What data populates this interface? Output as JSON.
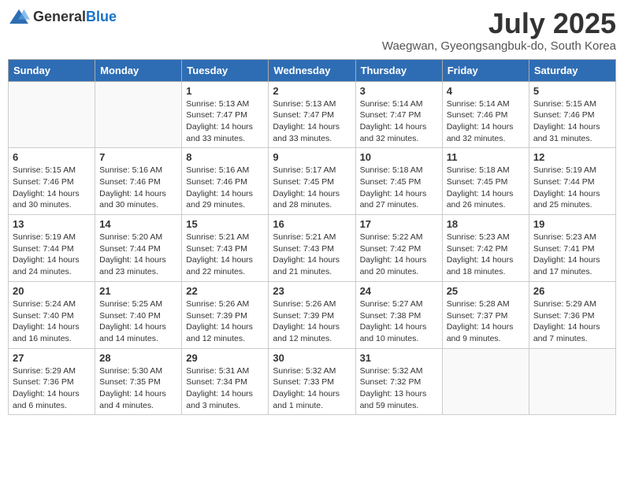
{
  "logo": {
    "general": "General",
    "blue": "Blue"
  },
  "title": "July 2025",
  "subtitle": "Waegwan, Gyeongsangbuk-do, South Korea",
  "headers": [
    "Sunday",
    "Monday",
    "Tuesday",
    "Wednesday",
    "Thursday",
    "Friday",
    "Saturday"
  ],
  "weeks": [
    [
      {
        "day": "",
        "text": ""
      },
      {
        "day": "",
        "text": ""
      },
      {
        "day": "1",
        "text": "Sunrise: 5:13 AM\nSunset: 7:47 PM\nDaylight: 14 hours and 33 minutes."
      },
      {
        "day": "2",
        "text": "Sunrise: 5:13 AM\nSunset: 7:47 PM\nDaylight: 14 hours and 33 minutes."
      },
      {
        "day": "3",
        "text": "Sunrise: 5:14 AM\nSunset: 7:47 PM\nDaylight: 14 hours and 32 minutes."
      },
      {
        "day": "4",
        "text": "Sunrise: 5:14 AM\nSunset: 7:46 PM\nDaylight: 14 hours and 32 minutes."
      },
      {
        "day": "5",
        "text": "Sunrise: 5:15 AM\nSunset: 7:46 PM\nDaylight: 14 hours and 31 minutes."
      }
    ],
    [
      {
        "day": "6",
        "text": "Sunrise: 5:15 AM\nSunset: 7:46 PM\nDaylight: 14 hours and 30 minutes."
      },
      {
        "day": "7",
        "text": "Sunrise: 5:16 AM\nSunset: 7:46 PM\nDaylight: 14 hours and 30 minutes."
      },
      {
        "day": "8",
        "text": "Sunrise: 5:16 AM\nSunset: 7:46 PM\nDaylight: 14 hours and 29 minutes."
      },
      {
        "day": "9",
        "text": "Sunrise: 5:17 AM\nSunset: 7:45 PM\nDaylight: 14 hours and 28 minutes."
      },
      {
        "day": "10",
        "text": "Sunrise: 5:18 AM\nSunset: 7:45 PM\nDaylight: 14 hours and 27 minutes."
      },
      {
        "day": "11",
        "text": "Sunrise: 5:18 AM\nSunset: 7:45 PM\nDaylight: 14 hours and 26 minutes."
      },
      {
        "day": "12",
        "text": "Sunrise: 5:19 AM\nSunset: 7:44 PM\nDaylight: 14 hours and 25 minutes."
      }
    ],
    [
      {
        "day": "13",
        "text": "Sunrise: 5:19 AM\nSunset: 7:44 PM\nDaylight: 14 hours and 24 minutes."
      },
      {
        "day": "14",
        "text": "Sunrise: 5:20 AM\nSunset: 7:44 PM\nDaylight: 14 hours and 23 minutes."
      },
      {
        "day": "15",
        "text": "Sunrise: 5:21 AM\nSunset: 7:43 PM\nDaylight: 14 hours and 22 minutes."
      },
      {
        "day": "16",
        "text": "Sunrise: 5:21 AM\nSunset: 7:43 PM\nDaylight: 14 hours and 21 minutes."
      },
      {
        "day": "17",
        "text": "Sunrise: 5:22 AM\nSunset: 7:42 PM\nDaylight: 14 hours and 20 minutes."
      },
      {
        "day": "18",
        "text": "Sunrise: 5:23 AM\nSunset: 7:42 PM\nDaylight: 14 hours and 18 minutes."
      },
      {
        "day": "19",
        "text": "Sunrise: 5:23 AM\nSunset: 7:41 PM\nDaylight: 14 hours and 17 minutes."
      }
    ],
    [
      {
        "day": "20",
        "text": "Sunrise: 5:24 AM\nSunset: 7:40 PM\nDaylight: 14 hours and 16 minutes."
      },
      {
        "day": "21",
        "text": "Sunrise: 5:25 AM\nSunset: 7:40 PM\nDaylight: 14 hours and 14 minutes."
      },
      {
        "day": "22",
        "text": "Sunrise: 5:26 AM\nSunset: 7:39 PM\nDaylight: 14 hours and 12 minutes."
      },
      {
        "day": "23",
        "text": "Sunrise: 5:26 AM\nSunset: 7:39 PM\nDaylight: 14 hours and 12 minutes."
      },
      {
        "day": "24",
        "text": "Sunrise: 5:27 AM\nSunset: 7:38 PM\nDaylight: 14 hours and 10 minutes."
      },
      {
        "day": "25",
        "text": "Sunrise: 5:28 AM\nSunset: 7:37 PM\nDaylight: 14 hours and 9 minutes."
      },
      {
        "day": "26",
        "text": "Sunrise: 5:29 AM\nSunset: 7:36 PM\nDaylight: 14 hours and 7 minutes."
      }
    ],
    [
      {
        "day": "27",
        "text": "Sunrise: 5:29 AM\nSunset: 7:36 PM\nDaylight: 14 hours and 6 minutes."
      },
      {
        "day": "28",
        "text": "Sunrise: 5:30 AM\nSunset: 7:35 PM\nDaylight: 14 hours and 4 minutes."
      },
      {
        "day": "29",
        "text": "Sunrise: 5:31 AM\nSunset: 7:34 PM\nDaylight: 14 hours and 3 minutes."
      },
      {
        "day": "30",
        "text": "Sunrise: 5:32 AM\nSunset: 7:33 PM\nDaylight: 14 hours and 1 minute."
      },
      {
        "day": "31",
        "text": "Sunrise: 5:32 AM\nSunset: 7:32 PM\nDaylight: 13 hours and 59 minutes."
      },
      {
        "day": "",
        "text": ""
      },
      {
        "day": "",
        "text": ""
      }
    ]
  ]
}
